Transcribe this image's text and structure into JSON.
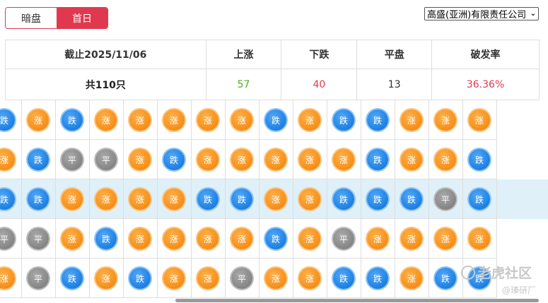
{
  "tabs": [
    {
      "label": "暗盘",
      "active": false
    },
    {
      "label": "首日",
      "active": true
    }
  ],
  "broker_select": {
    "selected": "高盛(亚洲)有限责任公司"
  },
  "summary": {
    "headers": {
      "date": "截止2025/11/06",
      "up": "上涨",
      "down": "下跌",
      "flat": "平盘",
      "rate": "破发率"
    },
    "values": {
      "total": "共110只",
      "up": "57",
      "down": "40",
      "flat": "13",
      "rate": "36.36%"
    }
  },
  "coin_labels": {
    "up": "涨",
    "down": "跌",
    "flat": "平"
  },
  "grid": {
    "highlighted_row": 2,
    "rows": [
      [
        "down",
        "up",
        "down",
        "up",
        "up",
        "up",
        "up",
        "up",
        "down",
        "up",
        "down",
        "down",
        "up",
        "up",
        "up"
      ],
      [
        "up",
        "down",
        "flat",
        "flat",
        "up",
        "down",
        "up",
        "up",
        "up",
        "up",
        "up",
        "down",
        "up",
        "up",
        "down"
      ],
      [
        "down",
        "down",
        "up",
        "up",
        "up",
        "up",
        "down",
        "down",
        "up",
        "up",
        "down",
        "down",
        "down",
        "flat",
        "down"
      ],
      [
        "flat",
        "flat",
        "up",
        "down",
        "up",
        "up",
        "up",
        "up",
        "down",
        "up",
        "flat",
        "up",
        "up",
        "up",
        "up"
      ],
      [
        "up",
        "flat",
        "down",
        "up",
        "down",
        "up",
        "up",
        "flat",
        "up",
        "up",
        "down",
        "down",
        "up",
        "down",
        "down"
      ]
    ]
  },
  "colors": {
    "accent": "#e0394f",
    "up_text": "#4caf1f",
    "down_text": "#e0394f",
    "up_coin": "#f7931e",
    "down_coin": "#2485e6",
    "flat_coin": "#8a8a8a",
    "row_highlight": "#dff0f8"
  },
  "watermark": {
    "main": "老虎社区",
    "sub": "@瑧研厂"
  }
}
